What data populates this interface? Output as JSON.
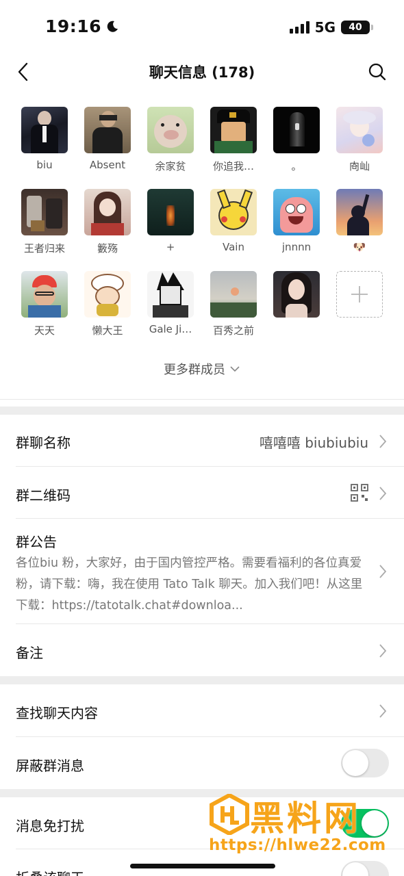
{
  "status_bar": {
    "time": "19:16",
    "network": "5G",
    "battery": "40"
  },
  "header": {
    "title": "聊天信息 (178)"
  },
  "members": [
    {
      "name": "biu"
    },
    {
      "name": "Absent"
    },
    {
      "name": "余家贫"
    },
    {
      "name": "你追我…"
    },
    {
      "name": "。"
    },
    {
      "name": "㕯屾"
    },
    {
      "name": "王者归来"
    },
    {
      "name": "籔殇"
    },
    {
      "name": "+"
    },
    {
      "name": "Vain"
    },
    {
      "name": "jnnnn"
    },
    {
      "name": "🐶"
    },
    {
      "name": "天天"
    },
    {
      "name": "懒大王"
    },
    {
      "name": "Gale Ji…"
    },
    {
      "name": "百秀之前"
    },
    {
      "name": ""
    }
  ],
  "more_members": "更多群成员",
  "settings": {
    "group_name_label": "群聊名称",
    "group_name_value": "嘻嘻嘻 biubiubiu",
    "qr_label": "群二维码",
    "notice_label": "群公告",
    "notice_text": "各位biu 粉，大家好，由于国内管控严格。需要看福利的各位真爱粉，请下载：嗨，我在使用 Tato Talk 聊天。加入我们吧！从这里下载：https://tatotalk.chat#downloa...",
    "remark_label": "备注",
    "search_label": "查找聊天内容",
    "block_label": "屏蔽群消息",
    "mute_label": "消息免打扰",
    "fold_label": "折叠该聊天"
  },
  "watermark": {
    "text": "黑料网",
    "url": "https://hlwe22.com"
  }
}
